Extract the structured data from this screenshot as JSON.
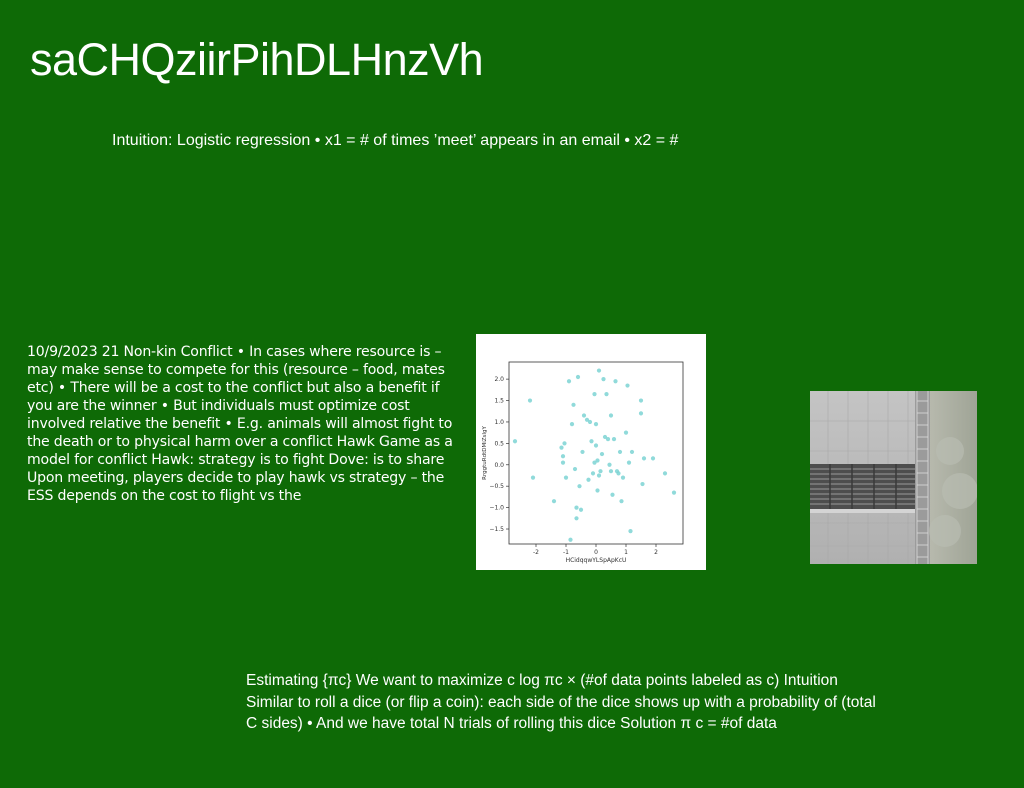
{
  "slide": {
    "title": "saCHQziirPihDLHnzVh",
    "subtitle": "Intuition: Logistic regression • x1 = # of times ’meet’ appears in an email • x2 = #",
    "body": "10/9/2023 21 Non-kin Conflict • In cases where resource is – may make sense to compete for this (resource – food, mates etc) • There will be a cost to the conflict but also a benefit if you are the winner • But individuals must optimize cost involved relative the benefit • E.g. animals will almost fight to the death or to physical harm over a conflict Hawk Game as a model for conflict Hawk: strategy is to fight Dove: is to share Upon meeting, players decide to play hawk vs strategy – the ESS depends on the cost to flight vs the",
    "bottom": "Estimating {πc} We want to maximize  c log πc × (#of data points labeled as c) Intuition Similar to roll a dice (or flip a coin): each side of the dice shows up with a probability of (total C sides) • And we have total N trials of rolling this dice Solution π c = #of data"
  },
  "photo": {
    "icon": "building-facade-photo"
  },
  "chart_data": {
    "type": "scatter",
    "xlabel": "HCidqqwYLSpApKcU",
    "ylabel": "RrggtuRdtDMiZsIgY",
    "xlim": [
      -2.9,
      2.9
    ],
    "ylim": [
      -1.85,
      2.4
    ],
    "xticks": [
      "-2",
      "-1",
      "0",
      "1",
      "2"
    ],
    "xtick_values": [
      -2,
      -1,
      0,
      1,
      2
    ],
    "yticks": [
      "2.0",
      "1.5",
      "1.0",
      "0.5",
      "0.0",
      "−0.5",
      "−1.0",
      "−1.5"
    ],
    "ytick_values": [
      2.0,
      1.5,
      1.0,
      0.5,
      0.0,
      -0.5,
      -1.0,
      -1.5
    ],
    "color": "#7dd3d3",
    "x": [
      -2.7,
      -2.2,
      -2.1,
      -1.4,
      -1.15,
      -1.1,
      -1.1,
      -1.05,
      -1.0,
      -0.9,
      -0.85,
      -0.8,
      -0.75,
      -0.7,
      -0.65,
      -0.65,
      -0.6,
      -0.55,
      -0.5,
      -0.45,
      -0.4,
      -0.3,
      -0.25,
      -0.2,
      -0.15,
      -0.1,
      -0.05,
      -0.05,
      0.0,
      0.0,
      0.05,
      0.05,
      0.1,
      0.1,
      0.15,
      0.2,
      0.25,
      0.3,
      0.35,
      0.4,
      0.45,
      0.5,
      0.5,
      0.55,
      0.6,
      0.65,
      0.7,
      0.75,
      0.8,
      0.85,
      0.9,
      1.0,
      1.05,
      1.1,
      1.15,
      1.2,
      1.5,
      1.5,
      1.55,
      1.6,
      1.9,
      2.3,
      2.6
    ],
    "y": [
      0.55,
      1.5,
      -0.3,
      -0.85,
      0.4,
      0.05,
      0.2,
      0.5,
      -0.3,
      1.95,
      -1.75,
      0.95,
      1.4,
      -0.1,
      -1.0,
      -1.25,
      2.05,
      -0.5,
      -1.05,
      0.3,
      1.15,
      1.05,
      -0.35,
      1.0,
      0.55,
      -0.2,
      0.05,
      1.65,
      0.95,
      0.45,
      -0.6,
      0.1,
      2.2,
      -0.25,
      -0.15,
      0.25,
      2.0,
      0.65,
      1.65,
      0.6,
      0.0,
      1.15,
      -0.15,
      -0.7,
      0.6,
      1.95,
      -0.15,
      -0.2,
      0.3,
      -0.85,
      -0.3,
      0.75,
      1.85,
      0.05,
      -1.55,
      0.3,
      1.5,
      1.2,
      -0.45,
      0.15,
      0.15,
      -0.2,
      -0.65
    ]
  }
}
